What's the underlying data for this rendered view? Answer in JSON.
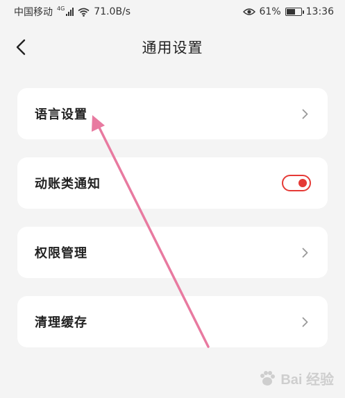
{
  "status_bar": {
    "carrier": "中国移动",
    "network_type": "4G",
    "speed": "71.0B/s",
    "battery_percent": "61%",
    "battery_level": 0.61,
    "time": "13:36"
  },
  "header": {
    "title": "通用设置"
  },
  "settings": [
    {
      "label": "语言设置",
      "control": "chevron"
    },
    {
      "label": "动账类通知",
      "control": "toggle",
      "toggle_on": true
    },
    {
      "label": "权限管理",
      "control": "chevron"
    },
    {
      "label": "清理缓存",
      "control": "chevron"
    }
  ],
  "colors": {
    "toggle_accent": "#e53935",
    "annotation_arrow": "#e87aa0",
    "background": "#f4f4f4"
  },
  "watermark": {
    "text": "Bai  经验",
    "icon": "baidu-paw-icon"
  }
}
